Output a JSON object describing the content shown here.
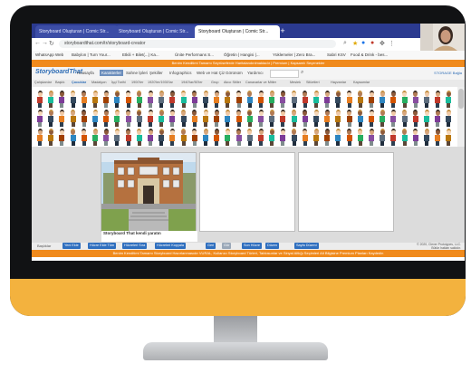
{
  "browser": {
    "tabs": [
      {
        "label": "Storyboard Oluşturan | Comic Str...",
        "active": false
      },
      {
        "label": "Storyboard Oluşturan | Comic Str...",
        "active": false
      },
      {
        "label": "Storyboard Oluşturan | Comic Str...",
        "active": true
      }
    ],
    "url": "storyboardthat.com/tr/storyboard-creator",
    "bookmarks": [
      "WhatsApp Web",
      "Babylon | Turn Your...",
      "Etkili + Bilet(...) Ka...",
      "Ünite Performans S...",
      "Öğretin | Hangisi |...",
      "Yüklemeler | Zero Bra...",
      "Sabri KSV",
      "Food & Drink - bes..."
    ]
  },
  "banners": {
    "top": "Benim Kenditimi Tamamı Seyrüseferde Haritalandırılmaktadır | Premium | Kapsamlı Seçenekler",
    "bottom": "Benim Kenditimi Tamamı Storyboard Hazırlanmasıdır VURAL, Kullanıcı Storyboard Türleri, Tablosunlar ve Sinyal Altlığı Seçimleri Alt Bilgisine Premium Planları Kaydedin"
  },
  "site": {
    "logo": "StoryboardThat",
    "nav": [
      "Anasayfa",
      "Karakterler",
      "Sahne İpleri",
      "Şekiller",
      "Infographics",
      "Web ve Hat Çiz",
      "Görünüm",
      "Yardımcı",
      "Ara"
    ],
    "nav_selected": 1,
    "login": "STORAGE Bağla",
    "categories": [
      "Çalışkanlar",
      "Başlık",
      "Çocuklar",
      "Madalyon",
      "İşçi Tarihi",
      "1900'ler",
      "1920'ler/1930'lar",
      "1940'lar/50'ler",
      "Grup",
      "Akıcı Stiller",
      "Canavarlar ve Mitler",
      "Meslek",
      "Silüetleri",
      "Hayvanlar",
      "Kapsamlar"
    ],
    "category_selected": 2
  },
  "storyboard": {
    "caption": "Storyboard That kendi yaratın"
  },
  "toolbar": {
    "label": "Başlıklar",
    "buttons": [
      "Yeni Ekle",
      "Hücre Ekle Tüm",
      "Hücreleri Sıra",
      "Hücreleri Kopyala",
      "Geri",
      "Gör",
      "Son Hücre",
      "Düzen",
      "Sayfa Düzeni"
    ],
    "copyright": "© 2020, Clever Prototypes, LLC. Bütün hakları saklıdır."
  },
  "colors": {
    "tab_bar": "#2b3a8f",
    "banner": "#f08a1c",
    "toolbar_button": "#2f6fbf",
    "monitor_chin": "#f3b23e",
    "monitor_frame": "#111214"
  }
}
